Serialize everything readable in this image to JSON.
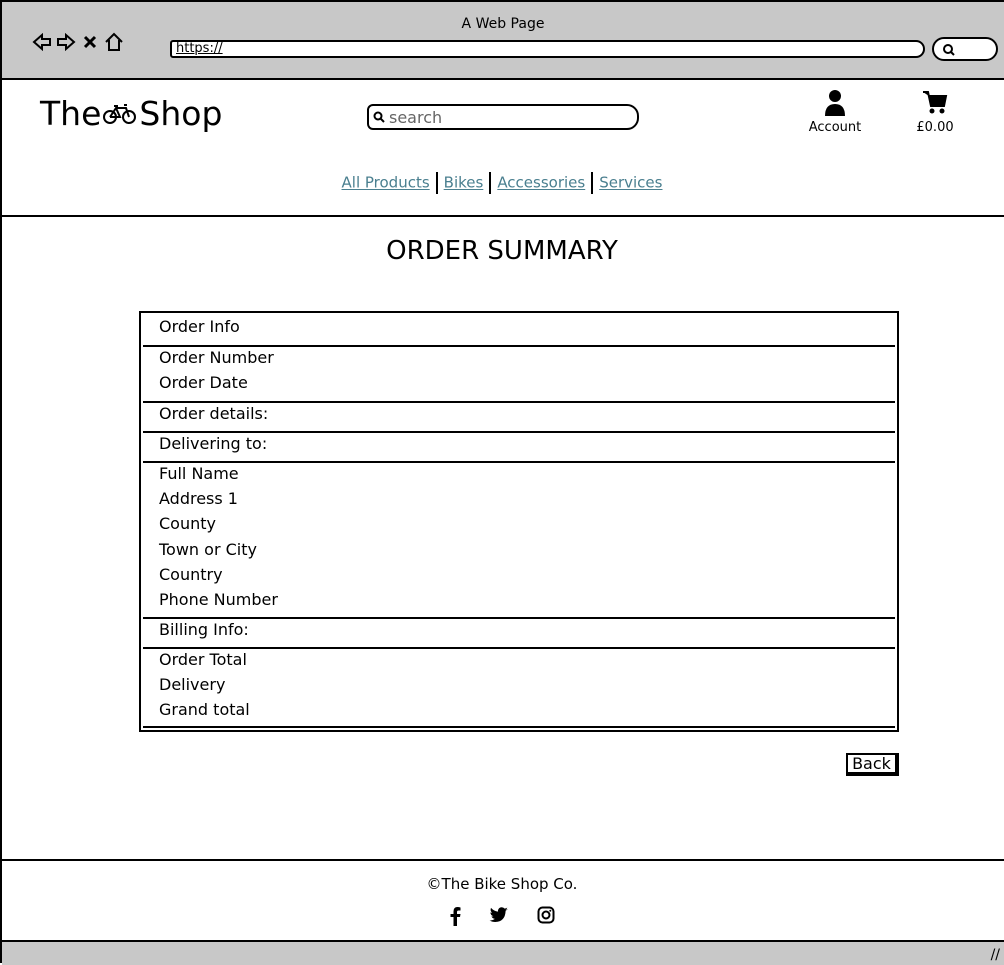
{
  "window": {
    "title": "A Web Page",
    "url": "https://"
  },
  "header": {
    "logo_left": "The",
    "logo_right": "Shop",
    "search_placeholder": "search",
    "account_label": "Account",
    "cart_total": "£0.00"
  },
  "nav": {
    "items": [
      "All Products",
      "Bikes",
      "Accessories",
      "Services"
    ]
  },
  "page": {
    "title": "ORDER SUMMARY"
  },
  "summary": {
    "order_info": "Order Info",
    "order_number": "Order Number",
    "order_date": "Order Date",
    "order_details": "Order details:",
    "delivering_to": "Delivering to:",
    "full_name": "Full Name",
    "address1": "Address 1",
    "county": "County",
    "town": "Town or City",
    "country": "Country",
    "phone": "Phone Number",
    "billing_info": "Billing Info:",
    "order_total": "Order Total",
    "delivery": "Delivery",
    "grand_total": "Grand total"
  },
  "actions": {
    "back_label": "Back"
  },
  "footer": {
    "copyright": "The Bike Shop Co.",
    "social_icons": [
      "facebook-icon",
      "twitter-icon",
      "instagram-icon"
    ]
  }
}
